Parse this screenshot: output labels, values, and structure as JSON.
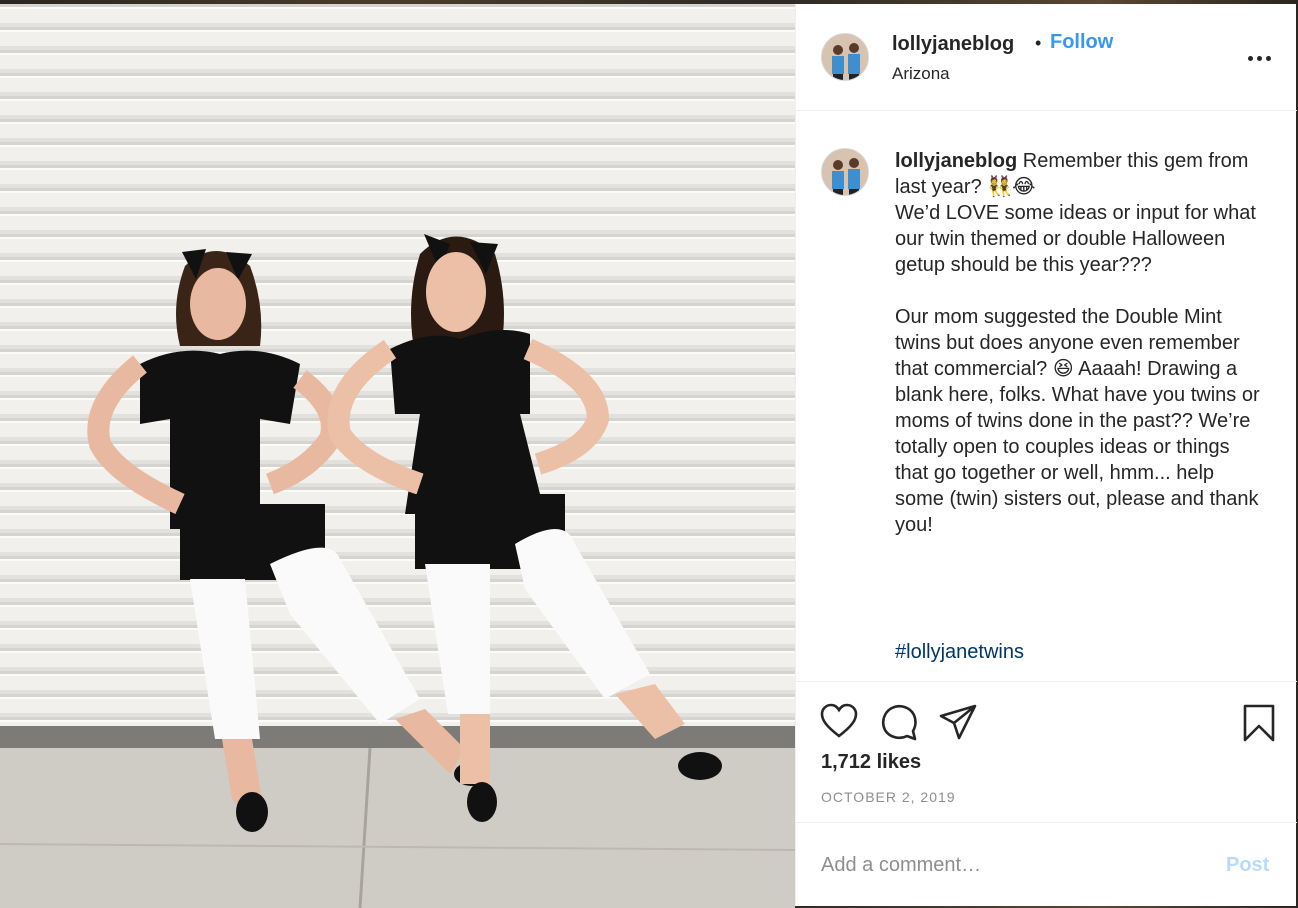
{
  "post": {
    "username": "lollyjaneblog",
    "follow_label": "Follow",
    "separator": "•",
    "location": "Arizona",
    "more_icon": "more-horizontal-icon"
  },
  "caption": {
    "username": "lollyjaneblog",
    "first_line": " Remember this gem from last year? 👯😂",
    "paragraph1": "We’d LOVE some ideas or input for what our twin themed or double Halloween getup should be this year???",
    "paragraph2": "Our mom suggested the Double Mint twins but does anyone even remember that commercial? 😆 Aaaah! Drawing a blank here, folks. What have you twins or moms of twins done in the past?? We’re totally open to couples ideas or things that go together or well, hmm... help some (twin) sisters out, please and thank you!",
    "hashtag": "#lollyjanetwins"
  },
  "actions": {
    "icons": [
      "heart-icon",
      "comment-icon",
      "share-icon",
      "bookmark-icon"
    ],
    "likes": "1,712 likes",
    "date": "OCTOBER 2, 2019"
  },
  "comment": {
    "placeholder": "Add a comment…",
    "post_label": "Post"
  }
}
